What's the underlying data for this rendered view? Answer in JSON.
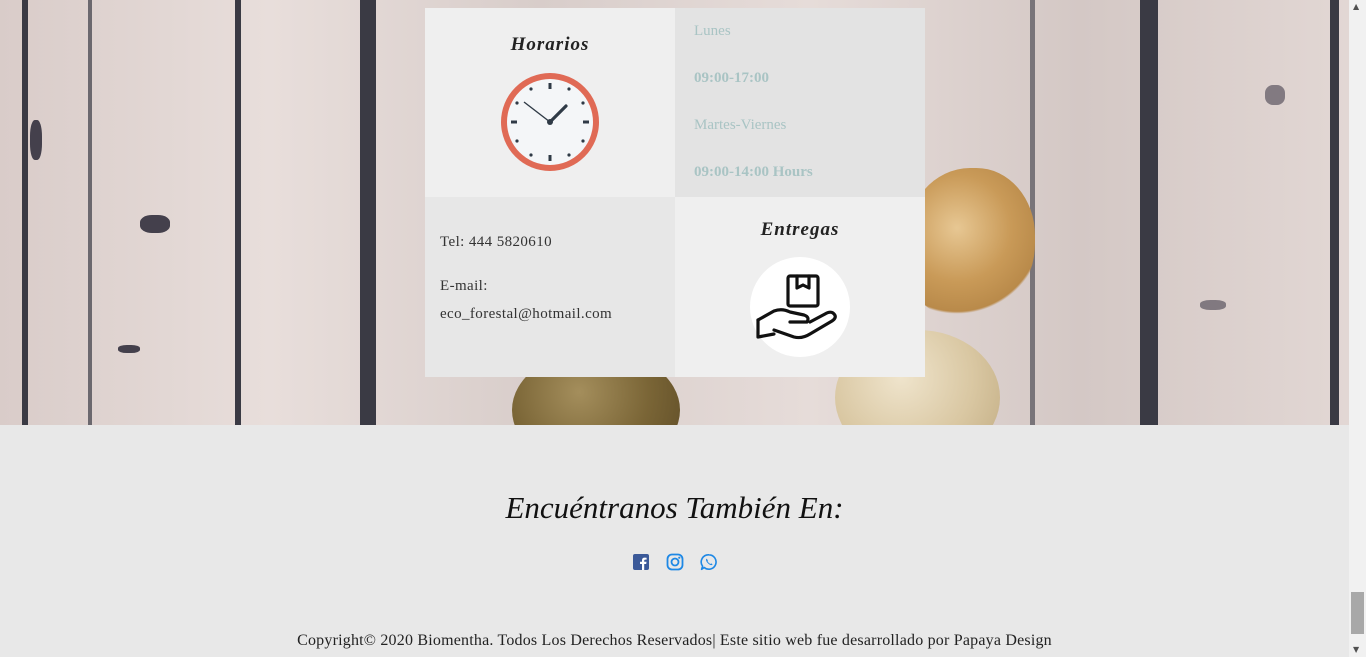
{
  "info": {
    "horarios_title": "Horarios",
    "entregas_title": "Entregas",
    "schedule": {
      "day1": "Lunes",
      "hours1": "09:00-17:00",
      "day2": "Martes-Viernes",
      "hours2": "09:00-14:00 Hours"
    },
    "contact": {
      "phone": "Tel: 444 5820610",
      "email_label": "E-mail:",
      "email": "eco_forestal@hotmail.com"
    },
    "colors": {
      "clock_ring": "#e06a55",
      "schedule_text": "#a9c4c4"
    }
  },
  "footer": {
    "follow_title": "Encuéntranos También En:",
    "socials": [
      {
        "icon": "facebook-icon",
        "color": "#3b5998"
      },
      {
        "icon": "instagram-icon",
        "color": "#1e88e5"
      },
      {
        "icon": "whatsapp-icon",
        "color": "#1e88e5"
      }
    ],
    "copyright": "Copyright© 2020 Biomentha. Todos Los Derechos Reservados| Este sitio web fue desarrollado por Papaya Design"
  }
}
